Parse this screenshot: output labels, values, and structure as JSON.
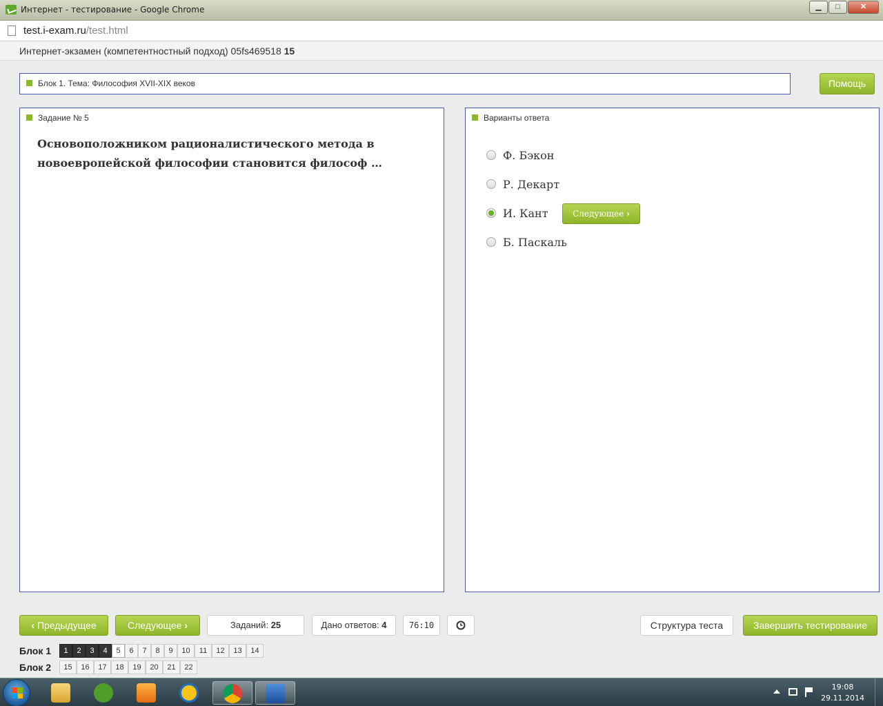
{
  "window": {
    "title": "Интернет - тестирование - Google Chrome",
    "minimize": "▁",
    "maximize": "□",
    "close": "✕"
  },
  "address": {
    "host": "test.i-exam.ru",
    "path": "/test.html"
  },
  "exam": {
    "title": "Интернет-экзамен (компетентностный подход) 05fs469518",
    "number": "15"
  },
  "block_topic": "Блок 1. Тема: Философия XVII-XIX веков",
  "help_label": "Помощь",
  "task": {
    "label": "Задание № 5",
    "question": "Основоположником рационалистического метода в новоевропейской философии становится философ …"
  },
  "answers": {
    "label": "Варианты ответа",
    "options": [
      "Ф. Бэкон",
      "Р. Декарт",
      "И. Кант",
      "Б. Паскаль"
    ],
    "selected_index": 2,
    "next_inline_label": "Следующее"
  },
  "footer": {
    "prev_label": "Предыдущее",
    "next_label": "Следующее",
    "tasks_label": "Заданий:",
    "tasks_value": "25",
    "answered_label": "Дано ответов:",
    "answered_value": "4",
    "timer": "76:10",
    "structure_label": "Структура теста",
    "finish_label": "Завершить тестирование"
  },
  "blocks": [
    {
      "label": "Блок 1",
      "items": [
        "1",
        "2",
        "3",
        "4",
        "5",
        "6",
        "7",
        "8",
        "9",
        "10",
        "11",
        "12",
        "13",
        "14"
      ],
      "done": [
        "1",
        "2",
        "3",
        "4"
      ],
      "current": "5"
    },
    {
      "label": "Блок 2",
      "items": [
        "15",
        "16",
        "17",
        "18",
        "19",
        "20",
        "21",
        "22"
      ],
      "done": [],
      "current": ""
    }
  ],
  "taskbar": {
    "time": "19:08",
    "date": "29.11.2014",
    "apps": [
      "explorer-icon",
      "utorrent-icon",
      "media-player-icon",
      "mail-agent-icon",
      "chrome-icon",
      "word-icon"
    ]
  }
}
